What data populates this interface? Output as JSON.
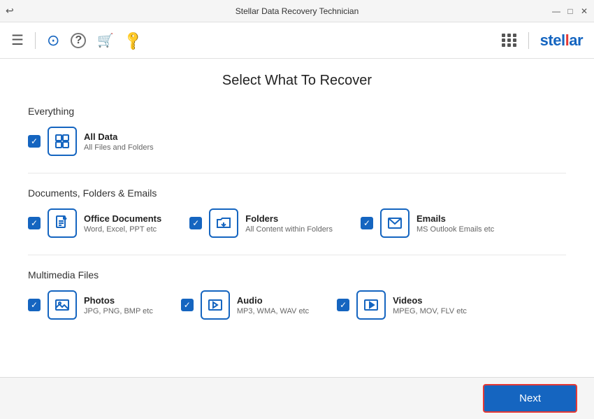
{
  "titleBar": {
    "title": "Stellar Data Recovery Technician",
    "backIcon": "↩",
    "minimizeIcon": "—",
    "maximizeIcon": "□",
    "closeIcon": "✕"
  },
  "toolbar": {
    "menuIcon": "☰",
    "historyIcon": "⊙",
    "helpIcon": "?",
    "cartIcon": "🛒",
    "keyIcon": "🔑",
    "gridLabel": "apps-grid",
    "logoText": "stel",
    "logoDot": "l",
    "logoSuffix": "ar"
  },
  "page": {
    "title": "Select What To Recover",
    "sections": [
      {
        "id": "everything",
        "label": "Everything",
        "options": [
          {
            "id": "all-data",
            "label": "All Data",
            "sublabel": "All Files and Folders",
            "checked": true
          }
        ]
      },
      {
        "id": "documents",
        "label": "Documents, Folders & Emails",
        "options": [
          {
            "id": "office-docs",
            "label": "Office Documents",
            "sublabel": "Word, Excel, PPT etc",
            "checked": true
          },
          {
            "id": "folders",
            "label": "Folders",
            "sublabel": "All Content within Folders",
            "checked": true
          },
          {
            "id": "emails",
            "label": "Emails",
            "sublabel": "MS Outlook Emails etc",
            "checked": true
          }
        ]
      },
      {
        "id": "multimedia",
        "label": "Multimedia Files",
        "options": [
          {
            "id": "photos",
            "label": "Photos",
            "sublabel": "JPG, PNG, BMP etc",
            "checked": true
          },
          {
            "id": "audio",
            "label": "Audio",
            "sublabel": "MP3, WMA, WAV etc",
            "checked": true
          },
          {
            "id": "videos",
            "label": "Videos",
            "sublabel": "MPEG, MOV, FLV etc",
            "checked": true
          }
        ]
      }
    ],
    "nextButton": "Next"
  }
}
